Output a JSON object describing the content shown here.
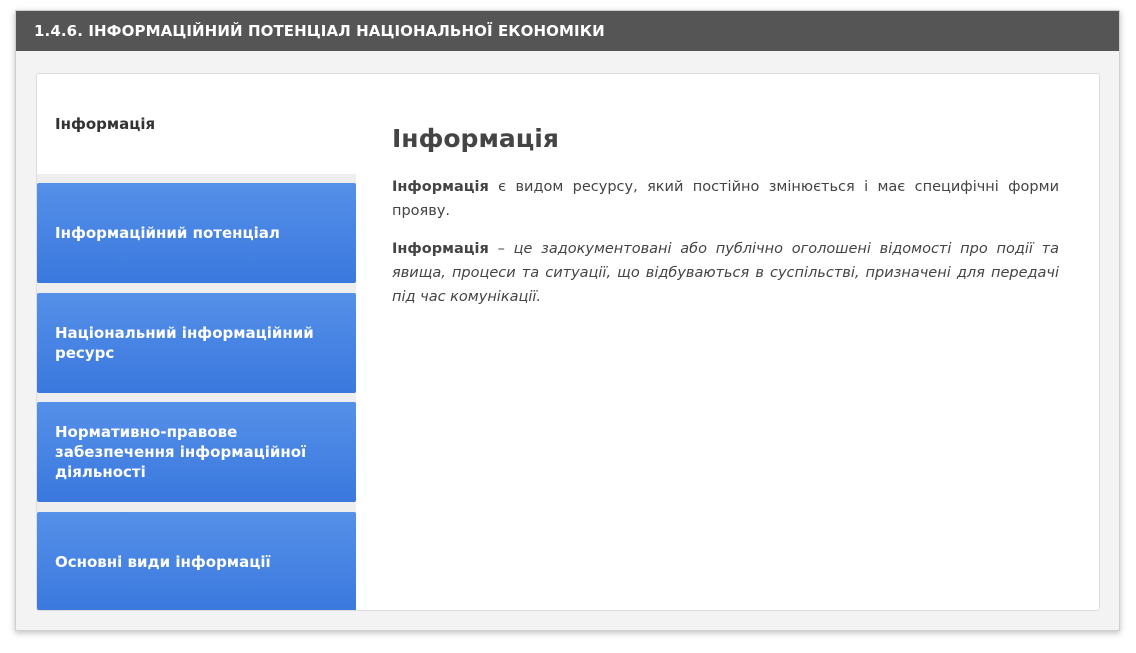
{
  "header": {
    "title": "1.4.6. ІНФОРМАЦІЙНИЙ ПОТЕНЦІАЛ НАЦІОНАЛЬНОЇ ЕКОНОМІКИ"
  },
  "tabs": [
    {
      "label": "Інформація",
      "active": true
    },
    {
      "label": "Інформаційний потенціал",
      "active": false
    },
    {
      "label": "Національний інформаційний ресурс",
      "active": false
    },
    {
      "label": "Нормативно-правове забезпечення інформаційної діяльності",
      "active": false
    },
    {
      "label": "Основні види інформації",
      "active": false
    }
  ],
  "content": {
    "heading": "Інформація",
    "paragraph1": {
      "term": "Інформація",
      "text": " є видом ресурсу, який постійно змінюється і має специфічні форми прояву."
    },
    "paragraph2": {
      "term": "Інформація",
      "text": " – це задокументовані або публічно оголошені відомості про події та явища, процеси та ситуації, що відбуваються в суспільстві, призначені для передачі під час комунікації."
    }
  },
  "colors": {
    "titlebar": "#555555",
    "tab_blue": "#3a78de",
    "active_tab": "#ffffff"
  }
}
